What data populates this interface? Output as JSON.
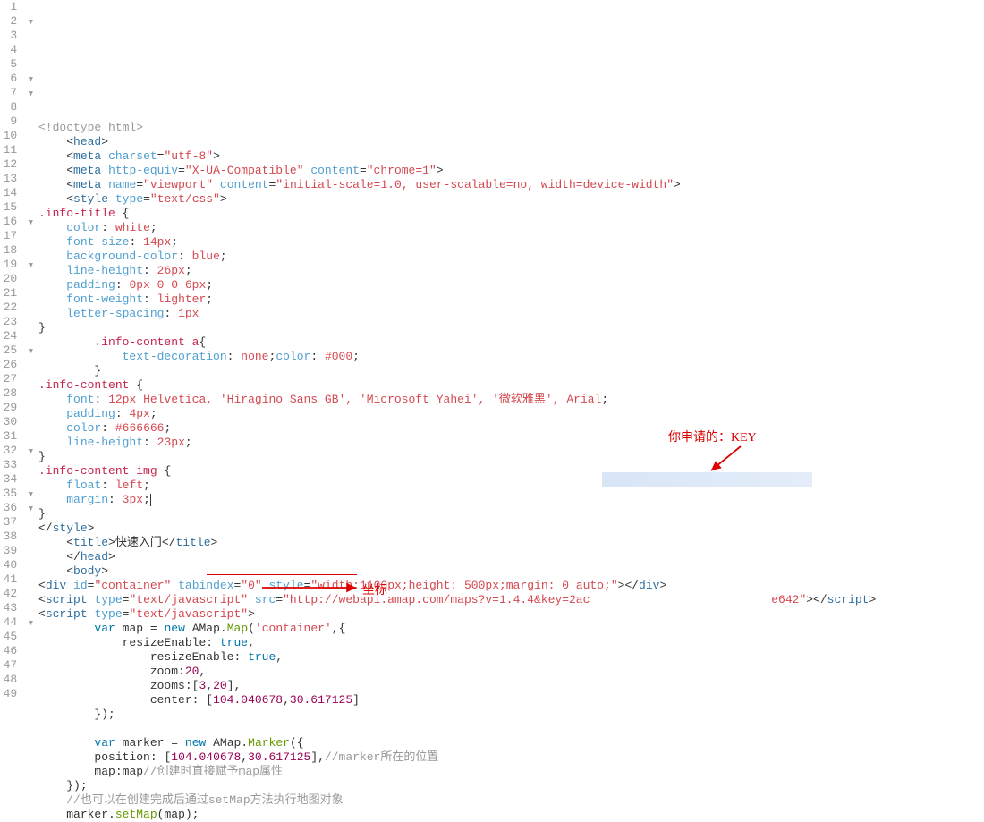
{
  "annotations": {
    "key_label": "你申请的：KEY",
    "coord_label": "坐标"
  },
  "lines": [
    {
      "n": 1,
      "fold": "",
      "html": "<span class='c-doctype'>&lt;!doctype html&gt;</span>"
    },
    {
      "n": 2,
      "fold": "▼",
      "html": "    <span class='c-punc'>&lt;</span><span class='c-tag'>head</span><span class='c-punc'>&gt;</span>"
    },
    {
      "n": 3,
      "fold": "",
      "html": "    <span class='c-punc'>&lt;</span><span class='c-tag'>meta</span> <span class='c-attr'>charset</span><span class='c-punc'>=</span><span class='c-string'>\"utf-8\"</span><span class='c-punc'>&gt;</span>"
    },
    {
      "n": 4,
      "fold": "",
      "html": "    <span class='c-punc'>&lt;</span><span class='c-tag'>meta</span> <span class='c-attr'>http-equiv</span><span class='c-punc'>=</span><span class='c-string'>\"X-UA-Compatible\"</span> <span class='c-attr'>content</span><span class='c-punc'>=</span><span class='c-string'>\"chrome=1\"</span><span class='c-punc'>&gt;</span>"
    },
    {
      "n": 5,
      "fold": "",
      "html": "    <span class='c-punc'>&lt;</span><span class='c-tag'>meta</span> <span class='c-attr'>name</span><span class='c-punc'>=</span><span class='c-string'>\"viewport\"</span> <span class='c-attr'>content</span><span class='c-punc'>=</span><span class='c-string'>\"initial-scale=1.0, user-scalable=no, width=device-width\"</span><span class='c-punc'>&gt;</span>"
    },
    {
      "n": 6,
      "fold": "▼",
      "html": "    <span class='c-punc'>&lt;</span><span class='c-tag'>style</span> <span class='c-attr'>type</span><span class='c-punc'>=</span><span class='c-string'>\"text/css\"</span><span class='c-punc'>&gt;</span>"
    },
    {
      "n": 7,
      "fold": "▼",
      "html": "<span class='c-sel'>.info-title</span> <span class='c-brace'>{</span>"
    },
    {
      "n": 8,
      "fold": "",
      "html": "    <span class='c-prop'>color</span><span class='c-punc'>:</span> <span class='c-val'>white</span><span class='c-punc'>;</span>"
    },
    {
      "n": 9,
      "fold": "",
      "html": "    <span class='c-prop'>font-size</span><span class='c-punc'>:</span> <span class='c-val'>14px</span><span class='c-punc'>;</span>"
    },
    {
      "n": 10,
      "fold": "",
      "html": "    <span class='c-prop'>background-color</span><span class='c-punc'>:</span> <span class='c-val'>blue</span><span class='c-punc'>;</span>"
    },
    {
      "n": 11,
      "fold": "",
      "html": "    <span class='c-prop'>line-height</span><span class='c-punc'>:</span> <span class='c-val'>26px</span><span class='c-punc'>;</span>"
    },
    {
      "n": 12,
      "fold": "",
      "html": "    <span class='c-prop'>padding</span><span class='c-punc'>:</span> <span class='c-val'>0px 0 0 6px</span><span class='c-punc'>;</span>"
    },
    {
      "n": 13,
      "fold": "",
      "html": "    <span class='c-prop'>font-weight</span><span class='c-punc'>:</span> <span class='c-val'>lighter</span><span class='c-punc'>;</span>"
    },
    {
      "n": 14,
      "fold": "",
      "html": "    <span class='c-prop'>letter-spacing</span><span class='c-punc'>:</span> <span class='c-val'>1px</span>"
    },
    {
      "n": 15,
      "fold": "",
      "html": "<span class='c-brace'>}</span>"
    },
    {
      "n": 16,
      "fold": "▼",
      "html": "        <span class='c-sel'>.info-content a</span><span class='c-brace'>{</span>"
    },
    {
      "n": 17,
      "fold": "",
      "html": "            <span class='c-prop'>text-decoration</span><span class='c-punc'>:</span> <span class='c-val'>none</span><span class='c-punc'>;</span><span class='c-prop'>color</span><span class='c-punc'>:</span> <span class='c-val'>#000</span><span class='c-punc'>;</span>"
    },
    {
      "n": 18,
      "fold": "",
      "html": "        <span class='c-brace'>}</span>"
    },
    {
      "n": 19,
      "fold": "▼",
      "html": "<span class='c-sel'>.info-content</span> <span class='c-brace'>{</span>"
    },
    {
      "n": 20,
      "fold": "",
      "html": "    <span class='c-prop'>font</span><span class='c-punc'>:</span> <span class='c-val'>12px Helvetica, 'Hiragino Sans GB', 'Microsoft Yahei', '微软雅黑', Arial</span><span class='c-punc'>;</span>"
    },
    {
      "n": 21,
      "fold": "",
      "html": "    <span class='c-prop'>padding</span><span class='c-punc'>:</span> <span class='c-val'>4px</span><span class='c-punc'>;</span>"
    },
    {
      "n": 22,
      "fold": "",
      "html": "    <span class='c-prop'>color</span><span class='c-punc'>:</span> <span class='c-val'>#666666</span><span class='c-punc'>;</span>"
    },
    {
      "n": 23,
      "fold": "",
      "html": "    <span class='c-prop'>line-height</span><span class='c-punc'>:</span> <span class='c-val'>23px</span><span class='c-punc'>;</span>"
    },
    {
      "n": 24,
      "fold": "",
      "html": "<span class='c-brace'>}</span>"
    },
    {
      "n": 25,
      "fold": "▼",
      "html": "<span class='c-sel'>.info-content img</span> <span class='c-brace'>{</span>"
    },
    {
      "n": 26,
      "fold": "",
      "html": "    <span class='c-prop'>float</span><span class='c-punc'>:</span> <span class='c-val'>left</span><span class='c-punc'>;</span>"
    },
    {
      "n": 27,
      "fold": "",
      "html": "    <span class='c-prop'>margin</span><span class='c-punc'>:</span> <span class='c-val'>3px</span><span class='c-punc'>;</span><span class='caret' data-name='text-cursor' data-interactable='false'></span>"
    },
    {
      "n": 28,
      "fold": "",
      "html": "<span class='c-brace'>}</span>"
    },
    {
      "n": 29,
      "fold": "",
      "html": "<span class='c-punc'>&lt;/</span><span class='c-tag'>style</span><span class='c-punc'>&gt;</span>"
    },
    {
      "n": 30,
      "fold": "",
      "html": "    <span class='c-punc'>&lt;</span><span class='c-tag'>title</span><span class='c-punc'>&gt;</span><span class='c-txt'>快速入门</span><span class='c-punc'>&lt;/</span><span class='c-tag'>title</span><span class='c-punc'>&gt;</span>"
    },
    {
      "n": 31,
      "fold": "",
      "html": "    <span class='c-punc'>&lt;/</span><span class='c-tag'>head</span><span class='c-punc'>&gt;</span>"
    },
    {
      "n": 32,
      "fold": "▼",
      "html": "    <span class='c-punc'>&lt;</span><span class='c-tag'>body</span><span class='c-punc'>&gt;</span>"
    },
    {
      "n": 33,
      "fold": "",
      "html": "<span class='c-punc'>&lt;</span><span class='c-tag'>div</span> <span class='c-attr'>id</span><span class='c-punc'>=</span><span class='c-string'>\"container\"</span> <span class='c-attr'>tabindex</span><span class='c-punc'>=</span><span class='c-string'>\"0\"</span> <span class='c-attr'>style</span><span class='c-punc'>=</span><span class='c-string'>\"width:1100px;height: 500px;margin: 0 auto;\"</span><span class='c-punc'>&gt;&lt;/</span><span class='c-tag'>div</span><span class='c-punc'>&gt;</span>"
    },
    {
      "n": 34,
      "fold": "",
      "html": "<span class='c-punc'>&lt;</span><span class='c-tag'>script</span> <span class='c-attr'>type</span><span class='c-punc'>=</span><span class='c-string'>\"text/javascript\"</span> <span class='c-attr'>src</span><span class='c-punc'>=</span><span class='c-string'>\"http://webapi.amap.com/maps?v=1.4.4&amp;key=2ac</span>                          <span class='c-string'>e642\"</span><span class='c-punc'>&gt;&lt;/</span><span class='c-tag'>script</span><span class='c-punc'>&gt;</span>"
    },
    {
      "n": 35,
      "fold": "▼",
      "html": "<span class='c-punc'>&lt;</span><span class='c-tag'>script</span> <span class='c-attr'>type</span><span class='c-punc'>=</span><span class='c-string'>\"text/javascript\"</span><span class='c-punc'>&gt;</span>"
    },
    {
      "n": 36,
      "fold": "▼",
      "html": "        <span class='c-js-kw'>var</span> <span class='c-txt'>map</span> <span class='c-punc'>=</span> <span class='c-js-kw'>new</span> <span class='c-txt'>AMap</span><span class='c-punc'>.</span><span class='c-func'>Map</span><span class='c-punc'>(</span><span class='c-string'>'container'</span><span class='c-punc'>,{</span>"
    },
    {
      "n": 37,
      "fold": "",
      "html": "            <span class='c-txt'>resizeEnable</span><span class='c-punc'>:</span> <span class='c-js-kw'>true</span><span class='c-punc'>,</span>"
    },
    {
      "n": 38,
      "fold": "",
      "html": "                <span class='c-txt'>resizeEnable</span><span class='c-punc'>:</span> <span class='c-js-kw'>true</span><span class='c-punc'>,</span>"
    },
    {
      "n": 39,
      "fold": "",
      "html": "                <span class='c-txt'>zoom</span><span class='c-punc'>:</span><span class='c-num'>20</span><span class='c-punc'>,</span>"
    },
    {
      "n": 40,
      "fold": "",
      "html": "                <span class='c-txt'>zooms</span><span class='c-punc'>:[</span><span class='c-num'>3</span><span class='c-punc'>,</span><span class='c-num'>20</span><span class='c-punc'>],</span>"
    },
    {
      "n": 41,
      "fold": "",
      "html": "                <span class='c-txt'>center</span><span class='c-punc'>:</span> <span class='c-punc'>[</span><span class='c-num'>104.040678</span><span class='c-punc'>,</span><span class='c-num'>30.617125</span><span class='c-punc'>]</span>"
    },
    {
      "n": 42,
      "fold": "",
      "html": "        <span class='c-punc'>});</span>"
    },
    {
      "n": 43,
      "fold": "",
      "html": ""
    },
    {
      "n": 44,
      "fold": "▼",
      "html": "        <span class='c-js-kw'>var</span> <span class='c-txt'>marker</span> <span class='c-punc'>=</span> <span class='c-js-kw'>new</span> <span class='c-txt'>AMap</span><span class='c-punc'>.</span><span class='c-func'>Marker</span><span class='c-punc'>({</span>"
    },
    {
      "n": 45,
      "fold": "",
      "html": "        <span class='c-txt'>position</span><span class='c-punc'>:</span> <span class='c-punc'>[</span><span class='c-num'>104.040678</span><span class='c-punc'>,</span><span class='c-num'>30.617125</span><span class='c-punc'>],</span><span class='c-comment'>//marker所在的位置</span>"
    },
    {
      "n": 46,
      "fold": "",
      "html": "        <span class='c-txt'>map</span><span class='c-punc'>:</span><span class='c-txt'>map</span><span class='c-comment'>//创建时直接赋予map属性</span>"
    },
    {
      "n": 47,
      "fold": "",
      "html": "    <span class='c-punc'>});</span>"
    },
    {
      "n": 48,
      "fold": "",
      "html": "    <span class='c-comment'>//也可以在创建完成后通过setMap方法执行地图对象</span>"
    },
    {
      "n": 49,
      "fold": "",
      "html": "    <span class='c-txt'>marker</span><span class='c-punc'>.</span><span class='c-func'>setMap</span><span class='c-punc'>(</span><span class='c-txt'>map</span><span class='c-punc'>);</span>"
    }
  ]
}
